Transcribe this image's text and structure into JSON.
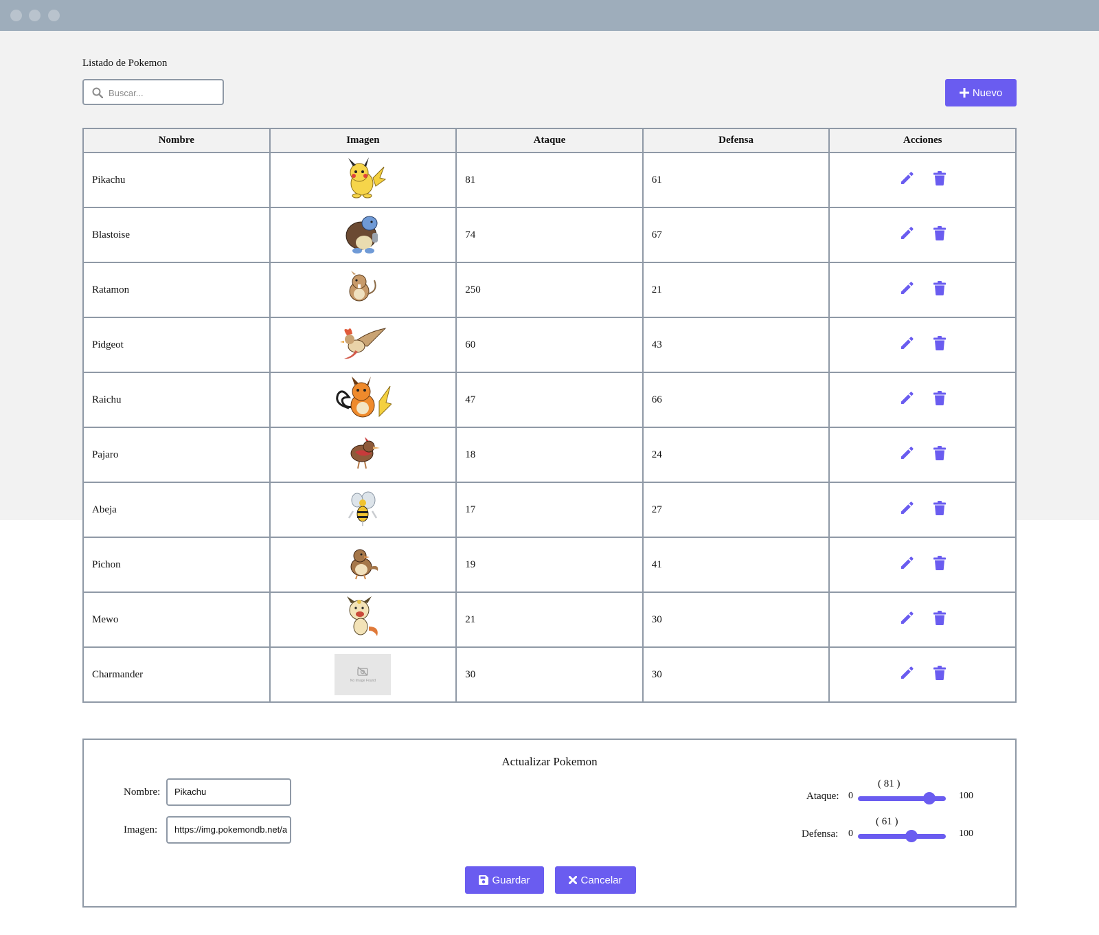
{
  "header": {
    "title": "Listado de Pokemon"
  },
  "search": {
    "placeholder": "Buscar..."
  },
  "toolbar": {
    "new_label": "Nuevo"
  },
  "table": {
    "columns": [
      "Nombre",
      "Imagen",
      "Ataque",
      "Defensa",
      "Acciones"
    ],
    "rows": [
      {
        "name": "Pikachu",
        "image": "pikachu",
        "attack": "81",
        "defense": "61"
      },
      {
        "name": "Blastoise",
        "image": "blastoise",
        "attack": "74",
        "defense": "67"
      },
      {
        "name": "Ratamon",
        "image": "raticate",
        "attack": "250",
        "defense": "21"
      },
      {
        "name": "Pidgeot",
        "image": "pidgeot",
        "attack": "60",
        "defense": "43"
      },
      {
        "name": "Raichu",
        "image": "raichu",
        "attack": "47",
        "defense": "66"
      },
      {
        "name": "Pajaro",
        "image": "spearow",
        "attack": "18",
        "defense": "24"
      },
      {
        "name": "Abeja",
        "image": "beedrill",
        "attack": "17",
        "defense": "27"
      },
      {
        "name": "Pichon",
        "image": "pidgey",
        "attack": "19",
        "defense": "41"
      },
      {
        "name": "Mewo",
        "image": "meowth",
        "attack": "21",
        "defense": "30"
      },
      {
        "name": "Charmander",
        "image": "no-image-found",
        "attack": "30",
        "defense": "30"
      }
    ]
  },
  "form": {
    "title": "Actualizar Pokemon",
    "name_label": "Nombre:",
    "name_value": "Pikachu",
    "image_label": "Imagen:",
    "image_value": "https://img.pokemondb.net/a",
    "attack_label": "Ataque:",
    "attack_value_display": "( 81 )",
    "attack_value": 81,
    "attack_min": "0",
    "attack_max": "100",
    "defense_label": "Defensa:",
    "defense_value_display": "( 61 )",
    "defense_value": 61,
    "defense_min": "0",
    "defense_max": "100",
    "save_label": "Guardar",
    "cancel_label": "Cancelar"
  },
  "colors": {
    "accent": "#6a5cf0",
    "border": "#8f99a6",
    "titlebar": "#9eadbb",
    "page_bg": "#f2f2f2"
  },
  "icons": {
    "search": "search-icon",
    "new": "plus-icon",
    "edit": "pencil-icon",
    "delete": "trash-icon",
    "save": "floppy-disk-icon",
    "cancel": "x-icon"
  }
}
